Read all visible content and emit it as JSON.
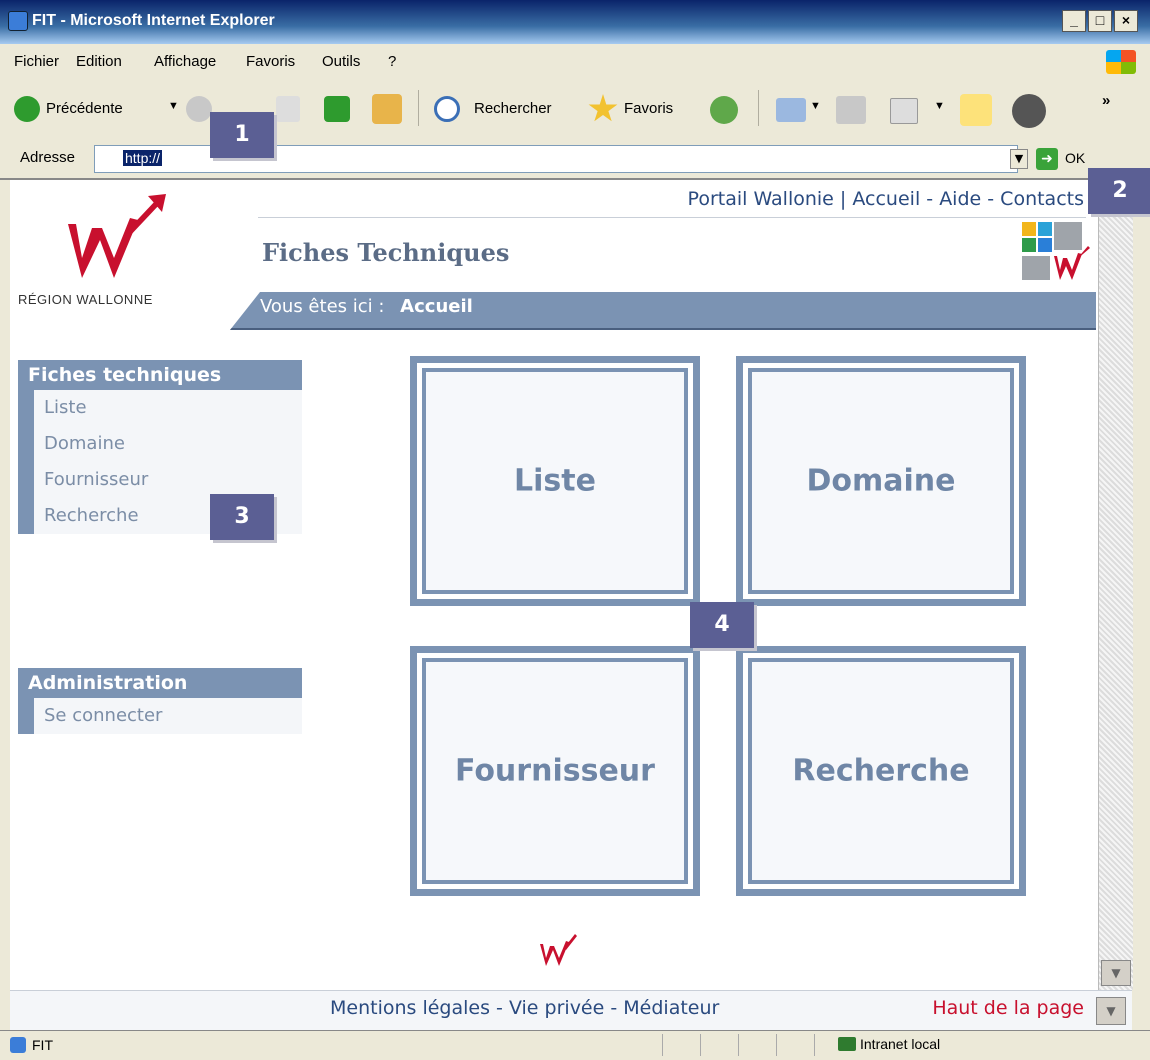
{
  "window": {
    "title": "FIT - Microsoft Internet Explorer",
    "controls": [
      "_",
      "□",
      "×"
    ]
  },
  "menu": [
    "Fichier",
    "Edition",
    "Affichage",
    "Favoris",
    "Outils",
    "?"
  ],
  "toolbar": {
    "back_label": "Précédente",
    "search_label": "Rechercher",
    "favorites_label": "Favoris",
    "chevron": "»"
  },
  "address": {
    "label": "Adresse",
    "value": "http://",
    "go_label": "OK"
  },
  "header": {
    "links": {
      "portail": "Portail Wallonie",
      "sep1": "|",
      "accueil": "Accueil",
      "sep2": "-",
      "aide": "Aide",
      "sep3": "-",
      "contacts": "Contacts"
    },
    "region": "RÉGION WALLONNE",
    "page_title": "Fiches Techniques",
    "breadcrumb_prefix": "Vous êtes ici :",
    "breadcrumb_current": "Accueil"
  },
  "sidebar": {
    "sections": [
      {
        "title": "Fiches techniques",
        "items": [
          "Liste",
          "Domaine",
          "Fournisseur",
          "Recherche"
        ]
      },
      {
        "title": "Administration",
        "items": [
          "Se connecter"
        ]
      }
    ]
  },
  "tiles": [
    "Liste",
    "Domaine",
    "Fournisseur",
    "Recherche"
  ],
  "footer": {
    "mentions": "Mentions légales",
    "sep1": "-",
    "vie_privee": "Vie privée",
    "sep2": "-",
    "mediateur": "Médiateur",
    "haut": "Haut de la page"
  },
  "status": {
    "text": "FIT",
    "zone": "Intranet local"
  },
  "callouts": [
    "1",
    "2",
    "3",
    "4"
  ],
  "colors": {
    "accent": "#7b93b3",
    "link": "#2a4a7f",
    "brand_red": "#c8102e",
    "callout": "#5b5f94"
  }
}
